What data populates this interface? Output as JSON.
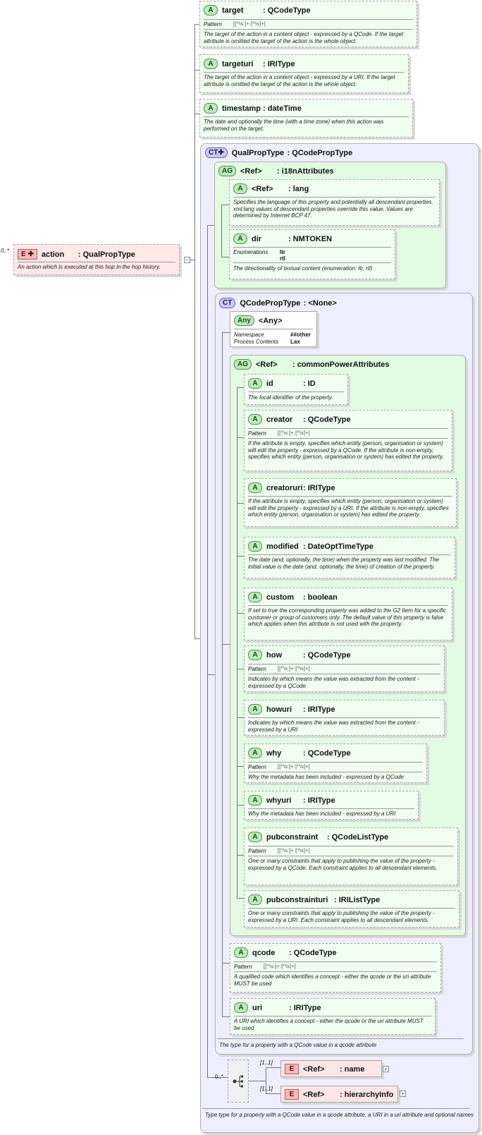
{
  "root": {
    "badge": "E",
    "multiplicity": "0..*",
    "name": "action",
    "type": ": QualPropType",
    "doc": "An action which is executed at this hop in the hop history."
  },
  "top_attrs": [
    {
      "badge": "A",
      "name": "target",
      "type": ": QCodeType",
      "pattern_label": "Pattern",
      "pattern": "[[^\\s:]+:[^\\s]+]",
      "doc": "The target of the action in a content object - expressed by a QCode. If the target attribute is omitted the target of the action is the whole object."
    },
    {
      "badge": "A",
      "name": "targeturi",
      "type": ": IRIType",
      "doc": "The target of the action in a content object - expressed by a URI. If the target attribute is omitted the target of the action is the whole object."
    },
    {
      "badge": "A",
      "name": "timestamp",
      "type": ": dateTime",
      "doc": "The date and optionally the time (with a time zone) when this action was performed on the target."
    }
  ],
  "qualprop": {
    "badge": "CT",
    "name": "QualPropType",
    "type": ": QCodePropType",
    "doc": "Type type for a property with a  QCode value in a qcode attribute, a URI in a uri attribute and optional names"
  },
  "i18n": {
    "badge": "AG",
    "ref": "<Ref>",
    "name": ": i18nAttributes",
    "lang": {
      "badge": "A",
      "ref": "<Ref>",
      "name": ": lang",
      "doc": "Specifies the language of this property and potentially all descendant properties. xml:lang values of descendant properties override this value. Values are determined by Internet BCP 47."
    },
    "dir": {
      "badge": "A",
      "name": "dir",
      "type": ": NMTOKEN",
      "enum_label": "Enumerations",
      "enum": [
        "ltr",
        "rtl"
      ],
      "doc": "The directionality of textual content (enumeration: ltr, rtl)"
    }
  },
  "qcodeprop": {
    "badge": "CT",
    "name": "QCodePropType",
    "type": ": <None>",
    "doc": "The type for a property with a QCode value in a qcode attribute"
  },
  "any": {
    "badge": "Any",
    "name": "<Any>",
    "ns_label": "Namespace",
    "ns": "##other",
    "pc_label": "Process Contents",
    "pc": "Lax"
  },
  "cpa": {
    "badge": "AG",
    "ref": "<Ref>",
    "name": ": commonPowerAttributes",
    "items": [
      {
        "badge": "A",
        "name": "id",
        "type": ": ID",
        "doc": "The local identifier of the property."
      },
      {
        "badge": "A",
        "name": "creator",
        "type": ": QCodeType",
        "pattern_label": "Pattern",
        "pattern": "[[^\\s:]+:[^\\s]+]",
        "doc": "If the attribute is empty, specifies which entity (person, organisation or system) will edit the property - expressed by a QCode. If the attribute is non-empty, specifies which entity (person, organisation or system) has edited the property."
      },
      {
        "badge": "A",
        "name": "creatoruri",
        "type": ": IRIType",
        "doc": "If the attribute is empty, specifies which entity (person, organisation or system) will edit the property - expressed by a URI. If the attribute is non-empty, specifies which entity (person, organisation or system) has edited the property."
      },
      {
        "badge": "A",
        "name": "modified",
        "type": ": DateOptTimeType",
        "doc": "The date (and, optionally, the time) when the property was last modified. The initial value is the date (and, optionally, the time) of creation of the property."
      },
      {
        "badge": "A",
        "name": "custom",
        "type": ": boolean",
        "doc": "If set to true the corresponding property was added to the G2 Item for a specific customer or group of customers only. The default value of this property is false which applies when this attribute is not used with the property."
      },
      {
        "badge": "A",
        "name": "how",
        "type": ": QCodeType",
        "pattern_label": "Pattern",
        "pattern": "[[^\\s:]+:[^\\s]+]",
        "doc": "Indicates by which means the value was extracted from the content - expressed by a QCode"
      },
      {
        "badge": "A",
        "name": "howuri",
        "type": ": IRIType",
        "doc": "Indicates by which means the value was extracted from the content - expressed by a URI"
      },
      {
        "badge": "A",
        "name": "why",
        "type": ": QCodeType",
        "pattern_label": "Pattern",
        "pattern": "[[^\\s:]+:[^\\s]+]",
        "doc": "Why the metadata has been included - expressed by a QCode"
      },
      {
        "badge": "A",
        "name": "whyuri",
        "type": ": IRIType",
        "doc": "Why the metadata has been included - expressed by a URI"
      },
      {
        "badge": "A",
        "name": "pubconstraint",
        "type": ": QCodeListType",
        "pattern_label": "Pattern",
        "pattern": "[[^\\s:]+:[^\\s]+]",
        "doc": "One or many constraints that apply to publishing the value of the property - expressed by a QCode. Each constraint applies to all descendant elements."
      },
      {
        "badge": "A",
        "name": "pubconstrainturi",
        "type": ": IRIListType",
        "doc": "One or many constraints that apply to publishing the value of the property - expressed by a URI. Each constraint applies to all descendant elements."
      }
    ]
  },
  "qcode_attrs": [
    {
      "badge": "A",
      "name": "qcode",
      "type": ": QCodeType",
      "pattern_label": "Pattern",
      "pattern": "[[^\\s:]+:[^\\s]+]",
      "doc": "A qualified code which identifies a concept  - either the  qcode or the uri attribute MUST be used"
    },
    {
      "badge": "A",
      "name": "uri",
      "type": ": IRIType",
      "doc": "A URI which identifies a concept  - either the  qcode or the uri attribute MUST be used"
    }
  ],
  "sequence": {
    "multiplicity": "0..*",
    "icon": "sequence-icon",
    "elements": [
      {
        "badge": "E",
        "multiplicity": "[1..1]",
        "ref": "<Ref>",
        "name": ": name"
      },
      {
        "badge": "E",
        "multiplicity": "[1..1]",
        "ref": "<Ref>",
        "name": ": hierarchyInfo"
      }
    ]
  },
  "colors": {
    "attribute_bg": "#f0fff0",
    "complex_bg": "#eeeeff",
    "group_bg": "#e2fbe2",
    "element_bg": "#ffe6e6"
  }
}
